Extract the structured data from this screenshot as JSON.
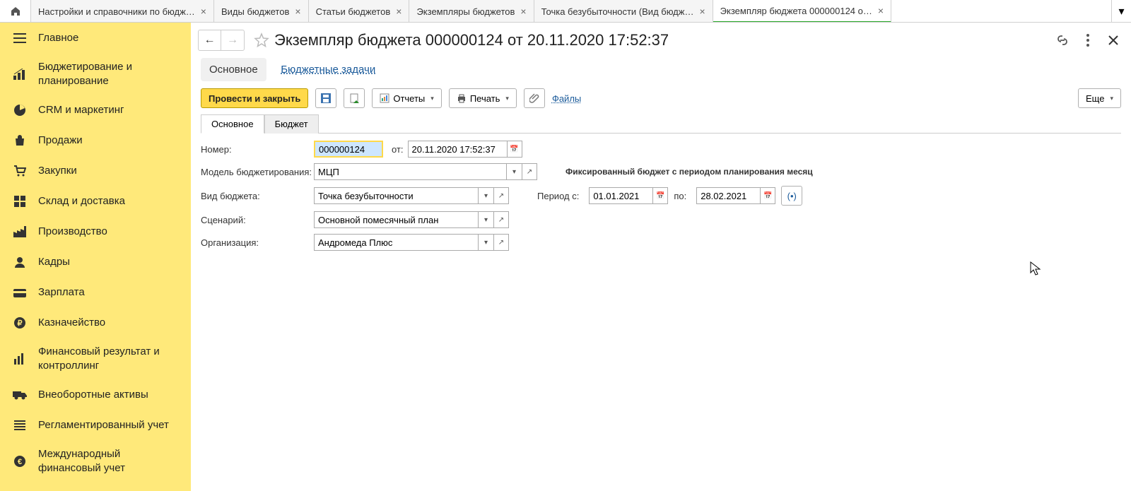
{
  "topbar": {
    "tabs": [
      {
        "label": "Настройки и справочники по бюдж…",
        "closable": true
      },
      {
        "label": "Виды  бюджетов",
        "closable": true
      },
      {
        "label": "Статьи бюджетов",
        "closable": true
      },
      {
        "label": "Экземпляры бюджетов",
        "closable": true
      },
      {
        "label": "Точка безубыточности (Вид бюдж…",
        "closable": true
      },
      {
        "label": "Экземпляр бюджета 000000124 о…",
        "closable": true,
        "active": true
      }
    ]
  },
  "sidebar": {
    "items": [
      {
        "label": "Главное"
      },
      {
        "label": "Бюджетирование и планирование"
      },
      {
        "label": "CRM и маркетинг"
      },
      {
        "label": "Продажи"
      },
      {
        "label": "Закупки"
      },
      {
        "label": "Склад и доставка"
      },
      {
        "label": "Производство"
      },
      {
        "label": "Кадры"
      },
      {
        "label": "Зарплата"
      },
      {
        "label": "Казначейство"
      },
      {
        "label": "Финансовый результат и контроллинг"
      },
      {
        "label": "Внеоборотные активы"
      },
      {
        "label": "Регламентированный учет"
      },
      {
        "label": "Международный финансовый учет"
      }
    ]
  },
  "page": {
    "title": "Экземпляр бюджета 000000124 от 20.11.2020 17:52:37",
    "subnav": {
      "main": "Основное",
      "link": "Бюджетные задачи"
    },
    "toolbar": {
      "post_close": "Провести и закрыть",
      "reports": "Отчеты",
      "print": "Печать",
      "files": "Файлы",
      "more": "Еще"
    },
    "inner_tabs": {
      "main": "Основное",
      "budget": "Бюджет"
    },
    "form": {
      "number_label": "Номер:",
      "number": "000000124",
      "from_label": "от:",
      "from": "20.11.2020 17:52:37",
      "model_label": "Модель бюджетирования:",
      "model": "МЦП",
      "model_hint": "Фиксированный бюджет с периодом планирования месяц",
      "kind_label": "Вид бюджета:",
      "kind": "Точка безубыточности",
      "scenario_label": "Сценарий:",
      "scenario": "Основной помесячный план",
      "org_label": "Организация:",
      "org": "Андромеда Плюс",
      "period_from_label": "Период с:",
      "period_from": "01.01.2021",
      "period_to_label": "по:",
      "period_to": "28.02.2021"
    }
  }
}
